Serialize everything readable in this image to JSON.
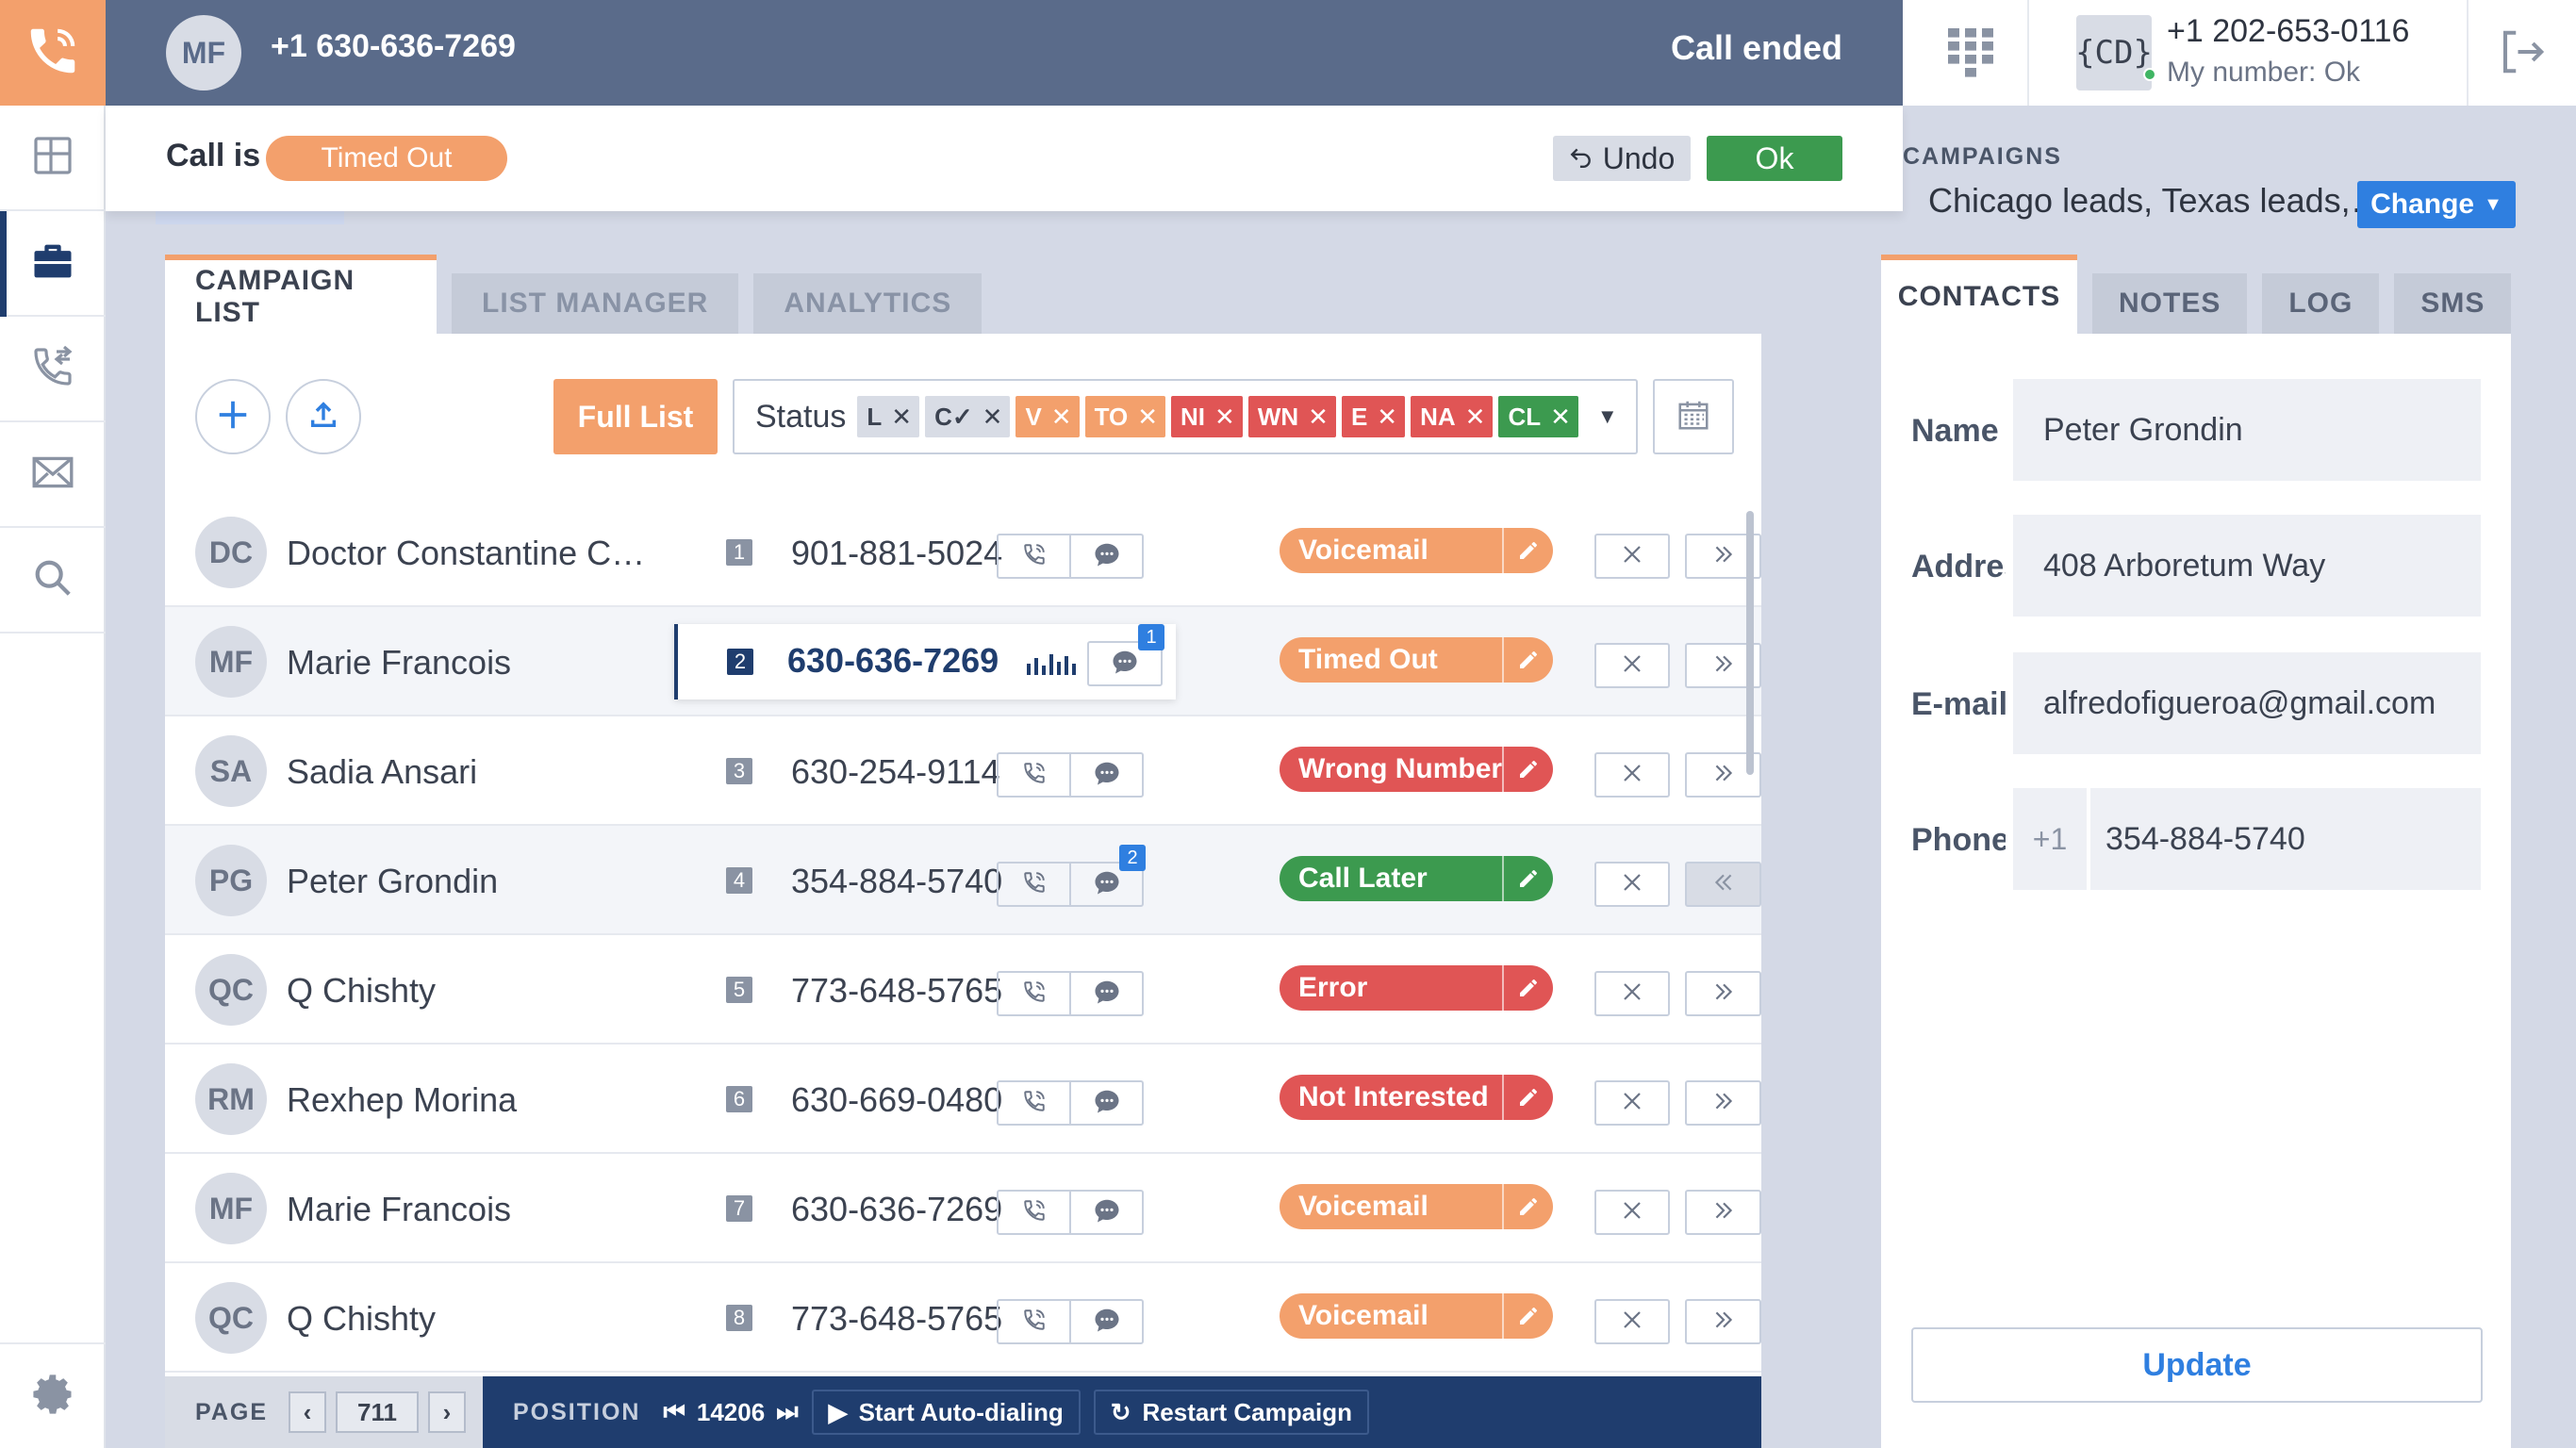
{
  "call": {
    "avatar_initials": "MF",
    "number": "+1 630-636-7269",
    "status": "Call ended",
    "call_is_label": "Call is",
    "call_status": "Timed Out",
    "undo_label": "Undo",
    "ok_label": "Ok"
  },
  "account": {
    "badge": "{CD}",
    "number": "+1 202-653-0116",
    "my_number": "My number: Ok"
  },
  "campaigns": {
    "label": "CAMPAIGNS",
    "value": "Chicago leads, Texas leads,…",
    "change_label": "Change"
  },
  "tabs": [
    "CAMPAIGN LIST",
    "LIST MANAGER",
    "ANALYTICS"
  ],
  "toolbar": {
    "full_list": "Full List",
    "status_label": "Status",
    "chips": [
      {
        "code": "L",
        "color": "#d8dce5",
        "text_color": "#3b4250"
      },
      {
        "code": "C✓",
        "color": "#d8dce5",
        "text_color": "#3b4250"
      },
      {
        "code": "V",
        "color": "#f3a06c",
        "text_color": "#ffffff"
      },
      {
        "code": "TO",
        "color": "#f3a06c",
        "text_color": "#ffffff"
      },
      {
        "code": "NI",
        "color": "#e05555",
        "text_color": "#ffffff"
      },
      {
        "code": "WN",
        "color": "#e05555",
        "text_color": "#ffffff"
      },
      {
        "code": "E",
        "color": "#e05555",
        "text_color": "#ffffff"
      },
      {
        "code": "NA",
        "color": "#e05555",
        "text_color": "#ffffff"
      },
      {
        "code": "CL",
        "color": "#3c9a4f",
        "text_color": "#ffffff"
      }
    ]
  },
  "rows": [
    {
      "initials": "DC",
      "name": "Doctor Constantine Con…",
      "index": "1",
      "phone": "901-881-5024",
      "status": "Voicemail",
      "status_color": "#f3a06c",
      "msg_badge": ""
    },
    {
      "initials": "MF",
      "name": "Marie Francois",
      "index": "2",
      "phone": "630-636-7269",
      "status": "Timed Out",
      "status_color": "#f3a06c",
      "msg_badge": "1",
      "active": true
    },
    {
      "initials": "SA",
      "name": "Sadia Ansari",
      "index": "3",
      "phone": "630-254-9114",
      "status": "Wrong Number",
      "status_color": "#e05555",
      "msg_badge": ""
    },
    {
      "initials": "PG",
      "name": "Peter Grondin",
      "index": "4",
      "phone": "354-884-5740",
      "status": "Call Later",
      "status_color": "#3c9a4f",
      "msg_badge": "2",
      "selected": true
    },
    {
      "initials": "QC",
      "name": "Q Chishty",
      "index": "5",
      "phone": "773-648-5765",
      "status": "Error",
      "status_color": "#e05555",
      "msg_badge": ""
    },
    {
      "initials": "RM",
      "name": "Rexhep Morina",
      "index": "6",
      "phone": "630-669-0480",
      "status": "Not Interested",
      "status_color": "#e05555",
      "msg_badge": ""
    },
    {
      "initials": "MF",
      "name": "Marie Francois",
      "index": "7",
      "phone": "630-636-7269",
      "status": "Voicemail",
      "status_color": "#f3a06c",
      "msg_badge": ""
    },
    {
      "initials": "QC",
      "name": "Q Chishty",
      "index": "8",
      "phone": "773-648-5765",
      "status": "Voicemail",
      "status_color": "#f3a06c",
      "msg_badge": ""
    }
  ],
  "pager": {
    "page_label": "PAGE",
    "page_value": "711",
    "position_label": "POSITION",
    "position_value": "14206",
    "start_label": "Start Auto-dialing",
    "restart_label": "Restart Campaign"
  },
  "right_tabs": [
    "CONTACTS",
    "NOTES",
    "LOG",
    "SMS"
  ],
  "contact": {
    "name_label": "Name",
    "name": "Peter Grondin",
    "address_label": "Address",
    "address": "408 Arboretum Way",
    "email_label": "E-mail",
    "email": "alfredofigueroa@gmail.com",
    "phone_label": "Phone",
    "phone_prefix": "+1",
    "phone": "354-884-5740",
    "update_label": "Update"
  }
}
